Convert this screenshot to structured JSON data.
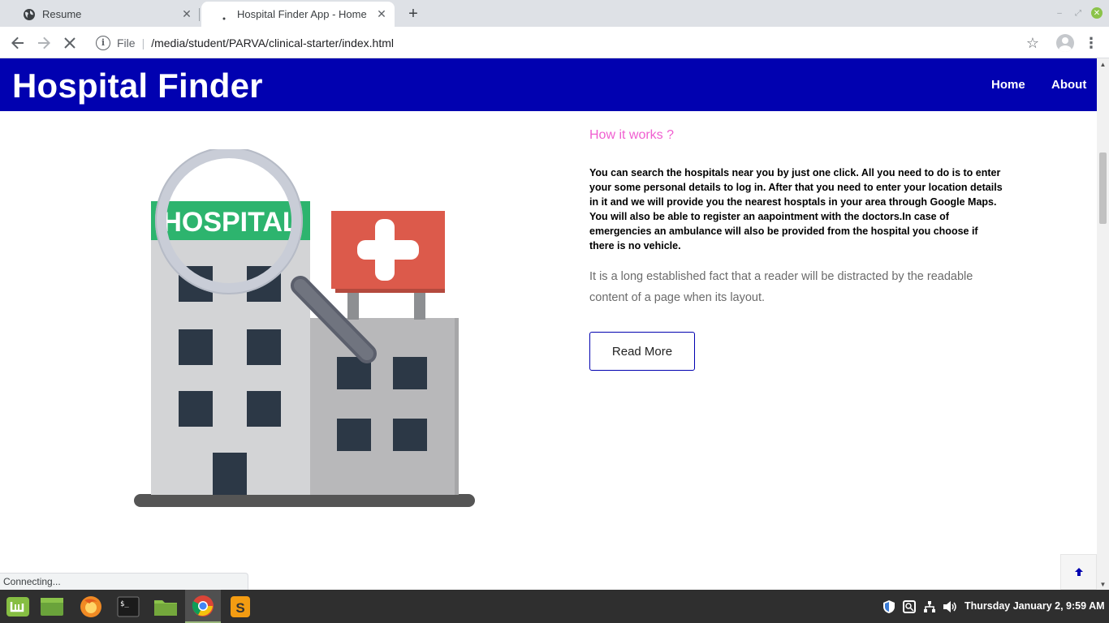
{
  "browser": {
    "tabs": [
      {
        "title": "Resume",
        "favicon": "globe-icon"
      },
      {
        "title": "Hospital Finder App - Home",
        "favicon": "loading-icon",
        "active": true
      }
    ],
    "address": {
      "scheme_label": "File",
      "url": "/media/student/PARVA/clinical-starter/index.html"
    },
    "status": "Connecting..."
  },
  "page": {
    "brand": "Hospital Finder",
    "nav": [
      "Home",
      "About"
    ],
    "illustration_sign": "HOSPITAL",
    "how_it_works": "How it works ?",
    "description": "You can search the hospitals near you by just one click. All you need to do is to enter your some personal details to log in. After that you need to enter your location details in it and we will provide you the nearest hosptals in your area through Google Maps. You will also be able to register an aapointment with the doctors.In case of emergencies an ambulance will also be provided from the hospital you choose if there is no vehicle.",
    "lead": "It is a long established fact that a reader will be distracted by the readable content of a page when its layout.",
    "read_more": "Read More",
    "back_to_top_icon": "arrow-up-icon"
  },
  "taskbar": {
    "apps": [
      "mint-menu-icon",
      "show-desktop-icon",
      "firefox-icon",
      "terminal-icon",
      "files-icon",
      "chrome-icon",
      "sublime-text-icon"
    ],
    "clock": "Thursday January  2,  9:59 AM"
  },
  "colors": {
    "navbar": "#0101b0",
    "accent_pink": "#f05ed0",
    "hospital_green": "#2db46e",
    "cross_red": "#dc5a4b"
  }
}
